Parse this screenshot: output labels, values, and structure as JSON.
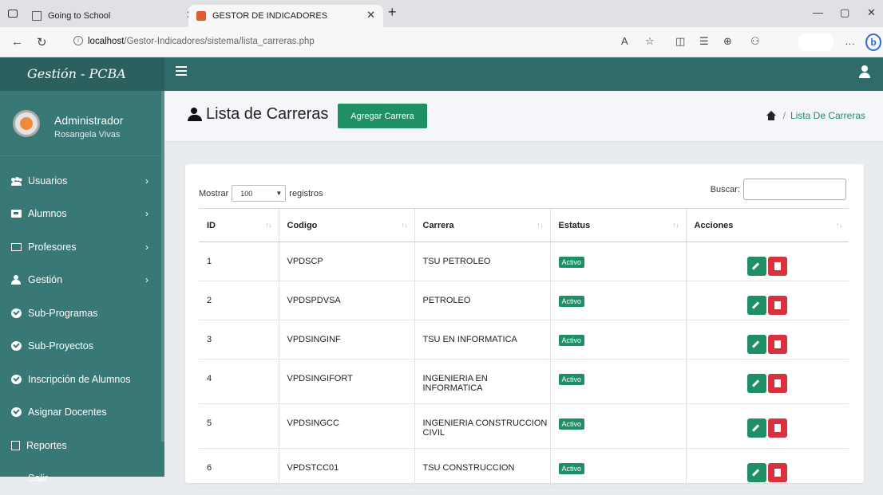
{
  "browser": {
    "tabs": [
      {
        "title": "Going to School"
      },
      {
        "title": "GESTOR DE INDICADORES"
      }
    ],
    "url_host": "localhost",
    "url_path": "/Gestor-Indicadores/sistema/lista_carreras.php"
  },
  "app": {
    "brand": "Gestión - PCBA"
  },
  "user": {
    "role": "Administrador",
    "name": "Rosangela Vivas"
  },
  "sidebar": {
    "items": [
      {
        "label": "Usuarios",
        "icon": "users-icon"
      },
      {
        "label": "Alumnos",
        "icon": "student-icon"
      },
      {
        "label": "Profesores",
        "icon": "teacher-icon"
      },
      {
        "label": "Gestión",
        "icon": "user-tie-icon"
      },
      {
        "label": "Sub-Programas",
        "icon": "check-circle-icon"
      },
      {
        "label": "Sub-Proyectos",
        "icon": "check-circle-icon"
      },
      {
        "label": "Inscripción de Alumnos",
        "icon": "check-circle-icon"
      },
      {
        "label": "Asignar Docentes",
        "icon": "check-circle-icon"
      },
      {
        "label": "Reportes",
        "icon": "pdf-icon"
      },
      {
        "label": "Salir",
        "icon": ""
      }
    ]
  },
  "page": {
    "title": "Lista de Carreras",
    "add_button": "Agregar Carrera",
    "breadcrumb": "Lista De Carreras"
  },
  "table_controls": {
    "show_label": "Mostrar",
    "page_size": "100",
    "records_label": "registros",
    "search_label": "Buscar:",
    "search_value": ""
  },
  "table": {
    "columns": [
      "ID",
      "Codigo",
      "Carrera",
      "Estatus",
      "Acciones"
    ],
    "rows": [
      {
        "id": "1",
        "codigo": "VPDSCP",
        "carrera": "TSU PETROLEO",
        "estatus": "Activo"
      },
      {
        "id": "2",
        "codigo": "VPDSPDVSA",
        "carrera": "PETROLEO",
        "estatus": "Activo"
      },
      {
        "id": "3",
        "codigo": "VPDSINGINF",
        "carrera": "TSU EN INFORMATICA",
        "estatus": "Activo"
      },
      {
        "id": "4",
        "codigo": "VPDSINGIFORT",
        "carrera": "INGENIERIA EN INFORMATICA",
        "estatus": "Activo"
      },
      {
        "id": "5",
        "codigo": "VPDSINGCC",
        "carrera": "INGENIERIA CONSTRUCCION CIVIL",
        "estatus": "Activo"
      },
      {
        "id": "6",
        "codigo": "VPDSTCC01",
        "carrera": "TSU CONSTRUCCION",
        "estatus": "Activo"
      }
    ]
  },
  "colors": {
    "topbar": "#2f6b6a",
    "sidebar": "#387876",
    "accent_green": "#1f8f66",
    "danger_red": "#d9323f"
  }
}
